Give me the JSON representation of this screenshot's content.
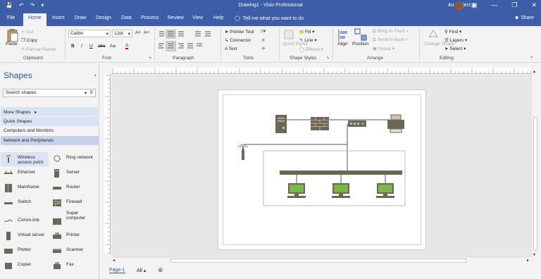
{
  "titlebar": {
    "title": "Drawing1 - Visio Professional",
    "account": "Au Project",
    "qat": [
      "💾",
      "↶",
      "↷",
      "▾"
    ],
    "win_buttons": [
      "▣",
      "—",
      "❐",
      "✕"
    ]
  },
  "tabs": [
    "File",
    "Home",
    "Insert",
    "Draw",
    "Design",
    "Data",
    "Process",
    "Review",
    "View",
    "Help"
  ],
  "tell_me": "Tell me what you want to do",
  "share": "Share",
  "ribbon": {
    "clipboard": {
      "paste": "Paste",
      "cut": "Cut",
      "copy": "Copy",
      "format_painter": "Format Painter",
      "label": "Clipboard"
    },
    "font": {
      "name": "Calibri",
      "size": "12pt.",
      "bold": "B",
      "italic": "I",
      "underline": "U",
      "strike": "abc",
      "case": "Aa",
      "grow": "A˄",
      "shrink": "A˅",
      "label": "Font"
    },
    "paragraph": {
      "label": "Paragraph"
    },
    "tools": {
      "pointer": "Pointer Tool",
      "connector": "Connector",
      "text": "Text",
      "label": "Tools"
    },
    "shape_styles": {
      "quick_styles": "Quick Styles",
      "fill": "Fill",
      "line": "Line",
      "effects": "Effects",
      "label": "Shape Styles"
    },
    "arrange": {
      "align": "Align",
      "position": "Position",
      "bring_front": "Bring to Front",
      "send_back": "Send to Back",
      "group": "Group",
      "label": "Arrange"
    },
    "editing": {
      "change_shape": "Change Shape",
      "find": "Find",
      "layers": "Layers",
      "select": "Select",
      "label": "Editing"
    }
  },
  "shapes_pane": {
    "title": "Shapes",
    "search_placeholder": "Search shapes",
    "stencils": [
      "More Shapes",
      "Quick Shapes",
      "Computers and Monitors",
      "Network and Peripherals"
    ],
    "items": [
      {
        "label": "Wireless access point",
        "icon": "wireless-icon"
      },
      {
        "label": "Ring network",
        "icon": "ring-network-icon"
      },
      {
        "label": "Ethernet",
        "icon": "ethernet-icon"
      },
      {
        "label": "Server",
        "icon": "server-icon"
      },
      {
        "label": "Mainframe",
        "icon": "mainframe-icon"
      },
      {
        "label": "Router",
        "icon": "router-icon"
      },
      {
        "label": "Switch",
        "icon": "switch-icon"
      },
      {
        "label": "Firewall",
        "icon": "firewall-icon"
      },
      {
        "label": "Comm-link",
        "icon": "comm-link-icon"
      },
      {
        "label": "Super computer",
        "icon": "super-computer-icon"
      },
      {
        "label": "Virtual server",
        "icon": "virtual-server-icon"
      },
      {
        "label": "Printer",
        "icon": "printer-icon"
      },
      {
        "label": "Plotter",
        "icon": "plotter-icon"
      },
      {
        "label": "Scanner",
        "icon": "scanner-icon"
      },
      {
        "label": "Copier",
        "icon": "copier-icon"
      },
      {
        "label": "Fax",
        "icon": "fax-icon"
      }
    ]
  },
  "page_tabs": {
    "page1": "Page-1",
    "all": "All ▴",
    "add": "⊕"
  },
  "colors": {
    "accent": "#2b579a",
    "titlebar": "#3c5da8",
    "shape": "#6e6654",
    "monitor": "#7ab648"
  }
}
